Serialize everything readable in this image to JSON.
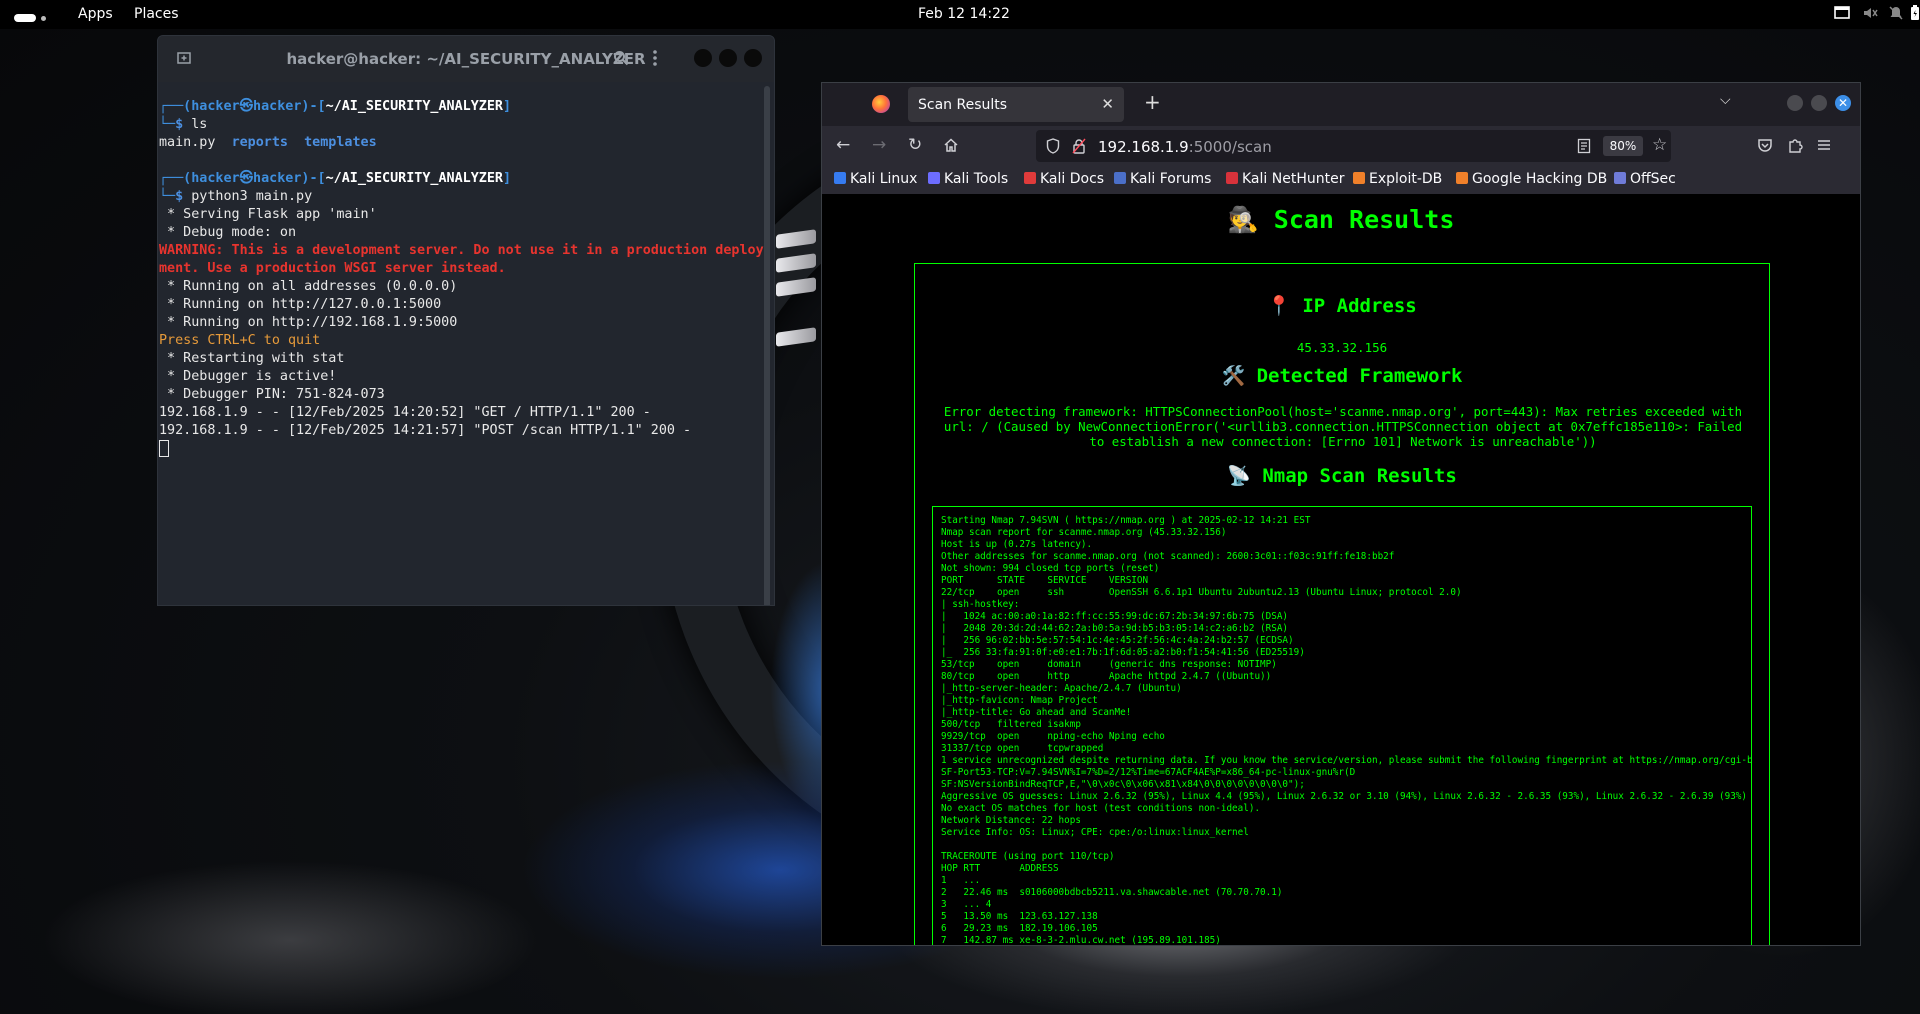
{
  "topbar": {
    "apps": "Apps",
    "places": "Places",
    "clock": "Feb 12  14:22"
  },
  "terminal": {
    "title": "hacker@hacker: ~/AI_SECURITY_ANALYZER",
    "lines": {
      "p1_user": "hacker",
      "p1_host": "hacker",
      "p1_path": "~/AI_SECURITY_ANALYZER",
      "cmd1": "ls",
      "ls_main": "main.py",
      "ls_reports": "reports",
      "ls_templates": "templates",
      "cmd2": "python3 main.py",
      "l1": " * Serving Flask app 'main'",
      "l2": " * Debug mode: on",
      "warn1": "WARNING: This is a development server. Do not use it in a production deploy",
      "warn2": "ment. Use a production WSGI server instead.",
      "l3": " * Running on all addresses (0.0.0.0)",
      "l4": " * Running on http://127.0.0.1:5000",
      "l5": " * Running on http://192.168.1.9:5000",
      "quit": "Press CTRL+C to quit",
      "l6": " * Restarting with stat",
      "l7": " * Debugger is active!",
      "l8": " * Debugger PIN: 751-824-073",
      "log1": "192.168.1.9 - - [12/Feb/2025 14:20:52] \"GET / HTTP/1.1\" 200 -",
      "log2": "192.168.1.9 - - [12/Feb/2025 14:21:57] \"POST /scan HTTP/1.1\" 200 -"
    }
  },
  "browser": {
    "tab_title": "Scan Results",
    "url_host": "192.168.1.9",
    "url_rest": ":5000/scan",
    "zoom": "80%",
    "bookmarks": [
      "Kali Linux",
      "Kali Tools",
      "Kali Docs",
      "Kali Forums",
      "Kali NetHunter",
      "Exploit-DB",
      "Google Hacking DB",
      "OffSec"
    ],
    "colors": {
      "accent": "#00ff00",
      "bg": "#000000"
    }
  },
  "page": {
    "title": "🕵️ Scan Results",
    "ip_heading": "📍 IP Address",
    "ip_value": "45.33.32.156",
    "fw_heading": "🛠️ Detected Framework",
    "fw_error": "Error detecting framework: HTTPSConnectionPool(host='scanme.nmap.org', port=443): Max retries exceeded with url: / (Caused by NewConnectionError('<urllib3.connection.HTTPSConnection object at 0x7effc185e110>: Failed to establish a new connection: [Errno 101] Network is unreachable'))",
    "nmap_heading": "📡 Nmap Scan Results",
    "nmap_output": "Starting Nmap 7.94SVN ( https://nmap.org ) at 2025-02-12 14:21 EST\nNmap scan report for scanme.nmap.org (45.33.32.156)\nHost is up (0.27s latency).\nOther addresses for scanme.nmap.org (not scanned): 2600:3c01::f03c:91ff:fe18:bb2f\nNot shown: 994 closed tcp ports (reset)\nPORT      STATE    SERVICE    VERSION\n22/tcp    open     ssh        OpenSSH 6.6.1p1 Ubuntu 2ubuntu2.13 (Ubuntu Linux; protocol 2.0)\n| ssh-hostkey:\n|   1024 ac:00:a0:1a:82:ff:cc:55:99:dc:67:2b:34:97:6b:75 (DSA)\n|   2048 20:3d:2d:44:62:2a:b0:5a:9d:b5:b3:05:14:c2:a6:b2 (RSA)\n|   256 96:02:bb:5e:57:54:1c:4e:45:2f:56:4c:4a:24:b2:57 (ECDSA)\n|_  256 33:fa:91:0f:e0:e1:7b:1f:6d:05:a2:b0:f1:54:41:56 (ED25519)\n53/tcp    open     domain     (generic dns response: NOTIMP)\n80/tcp    open     http       Apache httpd 2.4.7 ((Ubuntu))\n|_http-server-header: Apache/2.4.7 (Ubuntu)\n|_http-favicon: Nmap Project\n|_http-title: Go ahead and ScanMe!\n500/tcp   filtered isakmp\n9929/tcp  open     nping-echo Nping echo\n31337/tcp open     tcpwrapped\n1 service unrecognized despite returning data. If you know the service/version, please submit the following fingerprint at https://nmap.org/cgi-bin/submit.cgi?new-service :\nSF-Port53-TCP:V=7.94SVN%I=7%D=2/12%Time=67ACF4AE%P=x86_64-pc-linux-gnu%r(D\nSF:NSVersionBindReqTCP,E,\"\\0\\x0c\\0\\x06\\x81\\x84\\0\\0\\0\\0\\0\\0\\0\\0\");\nAggressive OS guesses: Linux 2.6.32 (95%), Linux 4.4 (95%), Linux 2.6.32 or 3.10 (94%), Linux 2.6.32 - 2.6.35 (93%), Linux 2.6.32 - 2.6.39 (93%)\nNo exact OS matches for host (test conditions non-ideal).\nNetwork Distance: 22 hops\nService Info: OS: Linux; CPE: cpe:/o:linux:linux_kernel\n\nTRACEROUTE (using port 110/tcp)\nHOP RTT       ADDRESS\n1   ...\n2   22.46 ms  s0106000bdbcb5211.va.shawcable.net (70.70.70.1)\n3   ... 4\n5   13.50 ms  123.63.127.138\n6   29.23 ms  182.19.106.105\n7   142.87 ms xe-8-3-2.mlu.cw.net (195.89.101.185)"
  }
}
